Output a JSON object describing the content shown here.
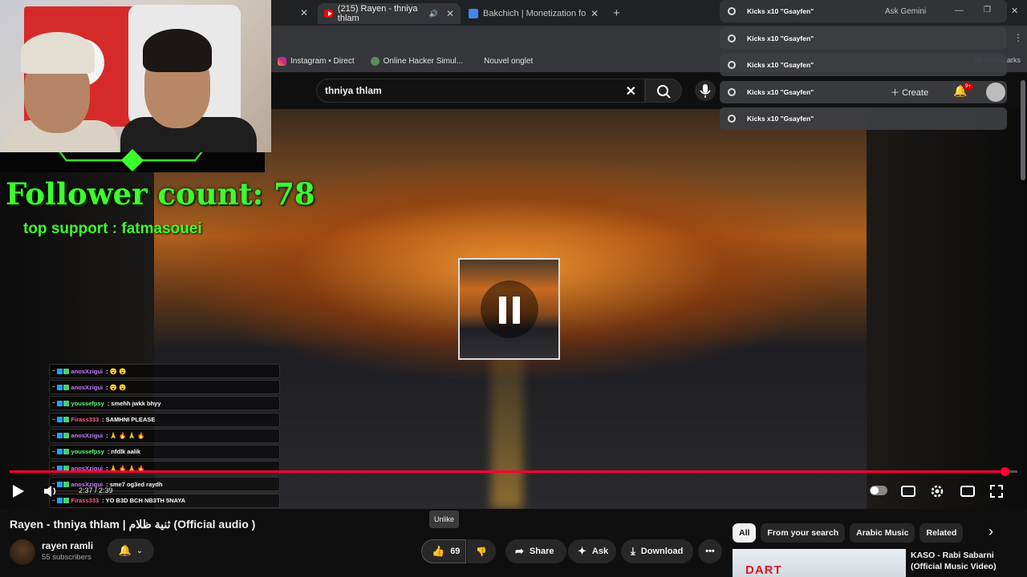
{
  "browser": {
    "tabs": [
      {
        "label": "(215) Rayen - thniya thlam",
        "active": true
      },
      {
        "label": "Bakchich | Monetization for afr",
        "active": false
      }
    ],
    "bookmarks": [
      "Instagram • Direct",
      "Online Hacker Simul...",
      "Nouvel onglet"
    ],
    "all_bookmarks": "All Bookmarks",
    "ask_gemini": "Ask Gemini"
  },
  "notifications": [
    {
      "text": "Kicks x10 \"Gsayfen\""
    },
    {
      "text": "Kicks x10 \"Gsayfen\""
    },
    {
      "text": "Kicks x10 \"Gsayfen\""
    },
    {
      "text": "Kicks x10 \"Gsayfen\""
    },
    {
      "text": "Kicks x10 \"Gsayfen\""
    }
  ],
  "youtube": {
    "search_value": "thniya thlam",
    "create_label": "Create",
    "notif_badge": "9+",
    "time": "2:37 / 2:39",
    "progress": 0.987,
    "title": "Rayen - thniya thlam | ثنية ظلام (Official audio )",
    "channel": "rayen ramli",
    "subscribers": "55 subscribers",
    "like_count": "69",
    "tooltip": "Unlike",
    "share_label": "Share",
    "ask_label": "Ask",
    "download_label": "Download",
    "chips": [
      "All",
      "From your search",
      "Arabic Music",
      "Related"
    ],
    "rec_title": "KASO - Rabi Sabarni (Official Music Video)",
    "rec_thumb_text": "DART"
  },
  "overlay": {
    "follower_label": "Follower count: 78",
    "top_support": "top support : fatmasouei"
  },
  "chat": [
    {
      "user": "anosXzigui",
      "color": "#c77dff",
      "msg": ": 😮 😮"
    },
    {
      "user": "anosXzigui",
      "color": "#c77dff",
      "msg": ": 😮 😮"
    },
    {
      "user": "youssefpsy",
      "color": "#5cff7a",
      "msg": ": smehh jwkk bhyy"
    },
    {
      "user": "Firass333",
      "color": "#ff5c8a",
      "msg": ": SAMHNI PLEASE"
    },
    {
      "user": "anosXzigui",
      "color": "#c77dff",
      "msg": ": 🙏 🔥 🙏 🔥"
    },
    {
      "user": "youssefpsy",
      "color": "#5cff7a",
      "msg": ": nfdlk aalik"
    },
    {
      "user": "anosXzigui",
      "color": "#c77dff",
      "msg": ": 🙏 🔥 🙏 🔥"
    },
    {
      "user": "anosXzigui",
      "color": "#c77dff",
      "msg": ": sme7 og3ed raydh"
    },
    {
      "user": "Firass333",
      "color": "#ff5c8a",
      "msg": ": YO B3D BCH NB3TH 5NAYA"
    },
    {
      "user": "anosXzigui",
      "color": "#c77dff",
      "msg": ": 🗣 🗣 🗣 🗣"
    },
    {
      "user": "anosXzigui",
      "color": "#c77dff",
      "msg": ": 🗣 🗣 🗣 🗣"
    }
  ]
}
